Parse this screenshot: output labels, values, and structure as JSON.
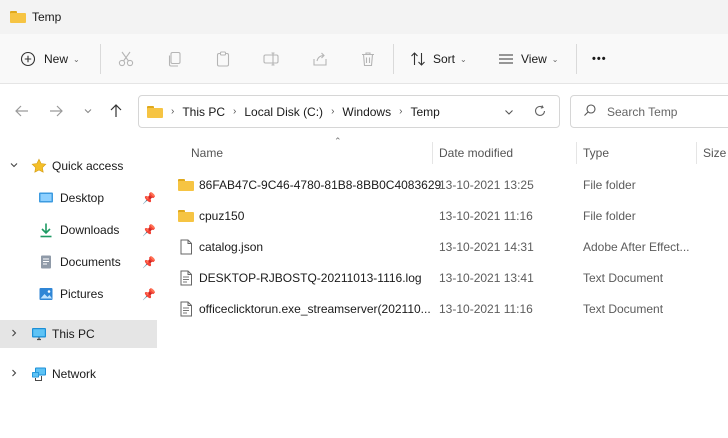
{
  "window": {
    "title": "Temp"
  },
  "toolbar": {
    "new_label": "New",
    "sort_label": "Sort",
    "view_label": "View",
    "more_label": "•••"
  },
  "address": {
    "crumbs": [
      "This PC",
      "Local Disk (C:)",
      "Windows",
      "Temp"
    ]
  },
  "search": {
    "placeholder": "Search Temp"
  },
  "sidebar": {
    "items": [
      {
        "label": "Quick access",
        "icon": "star-icon"
      },
      {
        "label": "Desktop",
        "icon": "desktop-icon",
        "pinned": true
      },
      {
        "label": "Downloads",
        "icon": "download-icon",
        "pinned": true
      },
      {
        "label": "Documents",
        "icon": "document-icon",
        "pinned": true
      },
      {
        "label": "Pictures",
        "icon": "pictures-icon",
        "pinned": true
      },
      {
        "label": "This PC",
        "icon": "computer-icon",
        "selected": true
      },
      {
        "label": "Network",
        "icon": "network-icon"
      }
    ]
  },
  "columns": {
    "name": "Name",
    "date": "Date modified",
    "type": "Type",
    "size": "Size"
  },
  "files": [
    {
      "name": "86FAB47C-9C46-4780-81B8-8BB0C4083629",
      "date": "13-10-2021 13:25",
      "type": "File folder",
      "icon": "folder-icon"
    },
    {
      "name": "cpuz150",
      "date": "13-10-2021 11:16",
      "type": "File folder",
      "icon": "folder-icon"
    },
    {
      "name": "catalog.json",
      "date": "13-10-2021 14:31",
      "type": "Adobe After Effect...",
      "icon": "file-icon"
    },
    {
      "name": "DESKTOP-RJBOSTQ-20211013-1116.log",
      "date": "13-10-2021 13:41",
      "type": "Text Document",
      "icon": "text-file-icon"
    },
    {
      "name": "officeclicktorun.exe_streamserver(202110...",
      "date": "13-10-2021 11:16",
      "type": "Text Document",
      "icon": "text-file-icon"
    }
  ],
  "colors": {
    "folder": "#f6c443",
    "accent": "#0067c0",
    "selected_bg": "#e5e5e5"
  }
}
